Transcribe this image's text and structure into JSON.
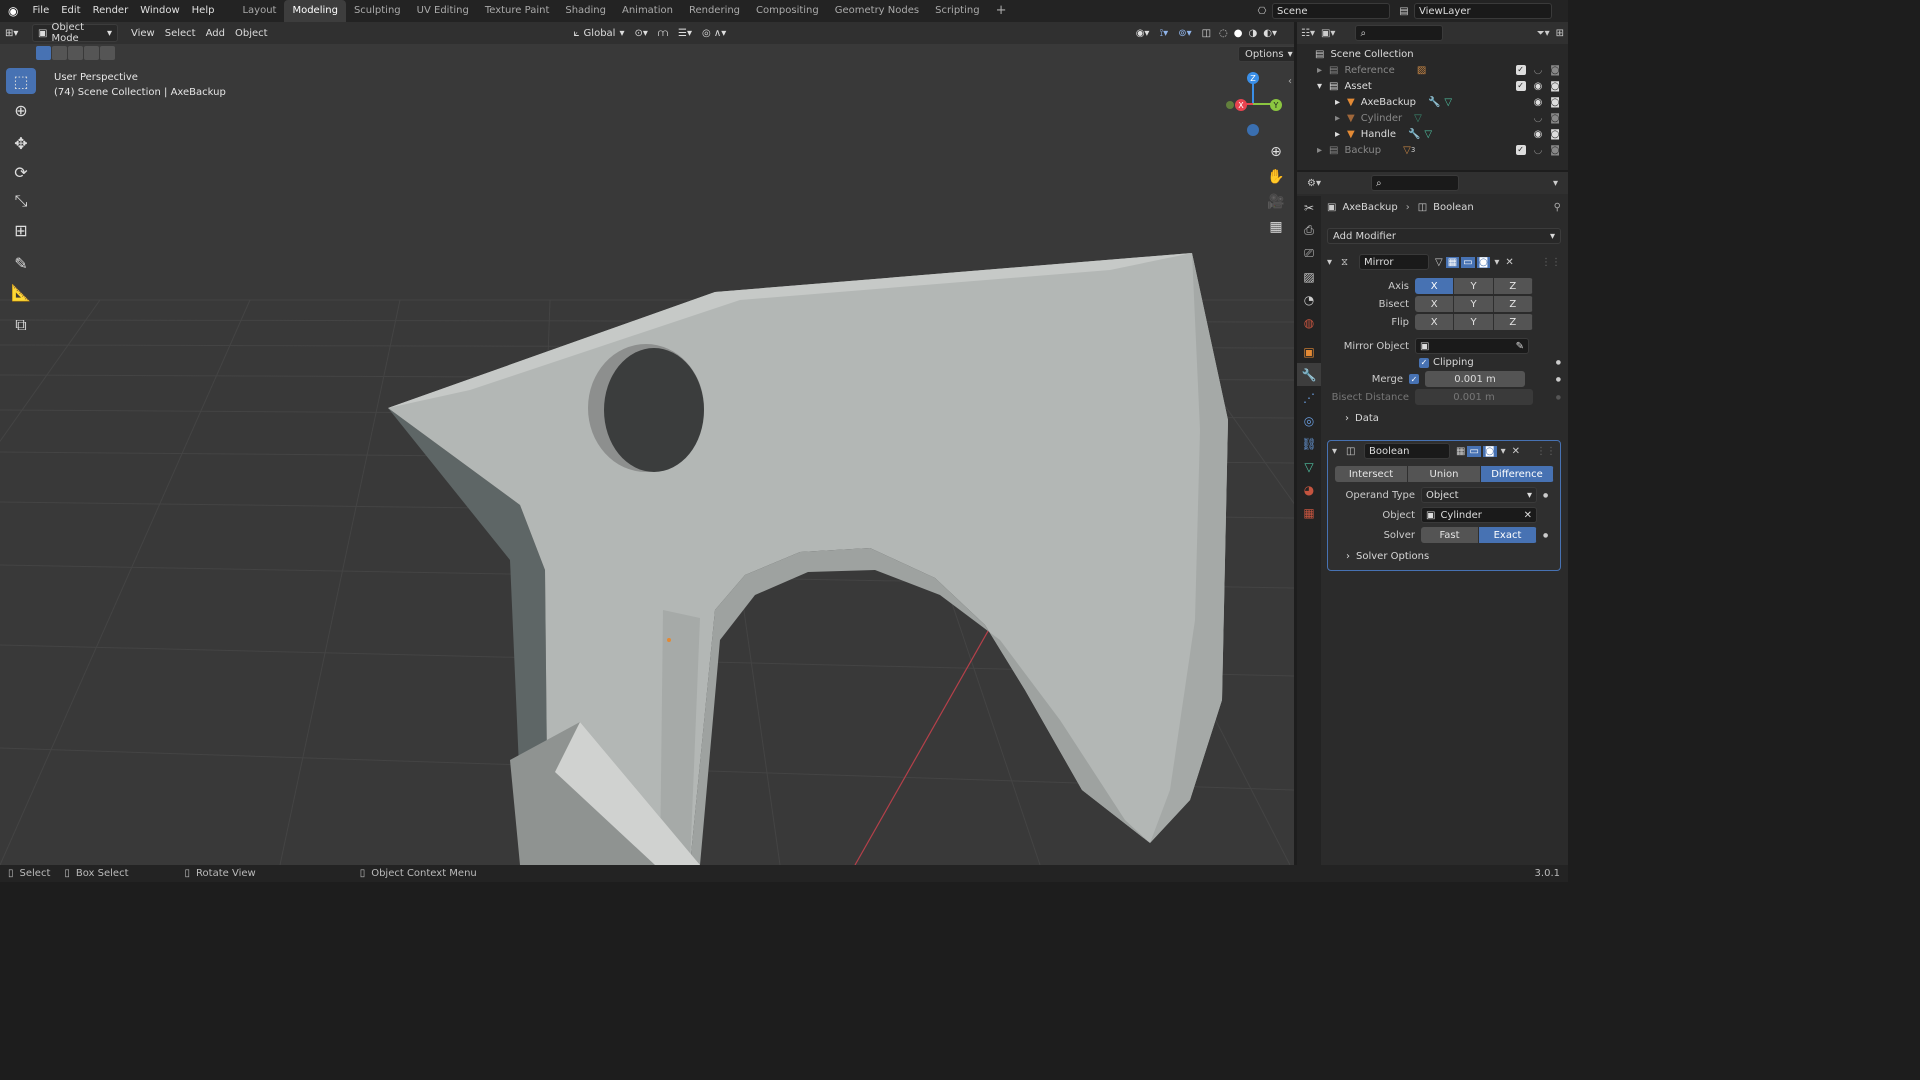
{
  "topbar": {
    "menus": [
      "File",
      "Edit",
      "Render",
      "Window",
      "Help"
    ],
    "workspaces": [
      "Layout",
      "Modeling",
      "Sculpting",
      "UV Editing",
      "Texture Paint",
      "Shading",
      "Animation",
      "Rendering",
      "Compositing",
      "Geometry Nodes",
      "Scripting"
    ],
    "active_workspace": "Modeling",
    "scene": "Scene",
    "view_layer": "ViewLayer"
  },
  "viewport_header": {
    "mode": "Object Mode",
    "menus": [
      "View",
      "Select",
      "Add",
      "Object"
    ],
    "orientation": "Global",
    "options": "Options"
  },
  "viewport": {
    "perspective": "User Perspective",
    "context": "(74) Scene Collection | AxeBackup",
    "gizmo": {
      "x": "X",
      "y": "Y",
      "z": "Z"
    }
  },
  "outliner": {
    "root": "Scene Collection",
    "items": [
      {
        "label": "Reference",
        "level": 1
      },
      {
        "label": "Asset",
        "level": 1
      },
      {
        "label": "AxeBackup",
        "level": 2
      },
      {
        "label": "Cylinder",
        "level": 2
      },
      {
        "label": "Handle",
        "level": 2
      },
      {
        "label": "Backup",
        "level": 1
      }
    ],
    "backup_badge": "3"
  },
  "properties": {
    "breadcrumb_object": "AxeBackup",
    "breadcrumb_modifier": "Boolean",
    "add_modifier": "Add Modifier",
    "mirror": {
      "name": "Mirror",
      "axis_label": "Axis",
      "bisect_label": "Bisect",
      "flip_label": "Flip",
      "xyz": [
        "X",
        "Y",
        "Z"
      ],
      "mirror_object_label": "Mirror Object",
      "clipping_label": "Clipping",
      "merge_label": "Merge",
      "merge_value": "0.001 m",
      "bisect_distance_label": "Bisect Distance",
      "bisect_distance_value": "0.001 m",
      "data_label": "Data"
    },
    "boolean": {
      "name": "Boolean",
      "ops": [
        "Intersect",
        "Union",
        "Difference"
      ],
      "operand_type_label": "Operand Type",
      "operand_type_value": "Object",
      "object_label": "Object",
      "object_value": "Cylinder",
      "solver_label": "Solver",
      "solvers": [
        "Fast",
        "Exact"
      ],
      "solver_options_label": "Solver Options"
    }
  },
  "statusbar": {
    "select": "Select",
    "box_select": "Box Select",
    "rotate_view": "Rotate View",
    "context_menu": "Object Context Menu",
    "version": "3.0.1"
  },
  "colors": {
    "accent": "#4772b3",
    "x_axis": "#e8434f",
    "y_axis": "#8bc640",
    "z_axis": "#3a8fe8",
    "object_orange": "#e38a35"
  }
}
